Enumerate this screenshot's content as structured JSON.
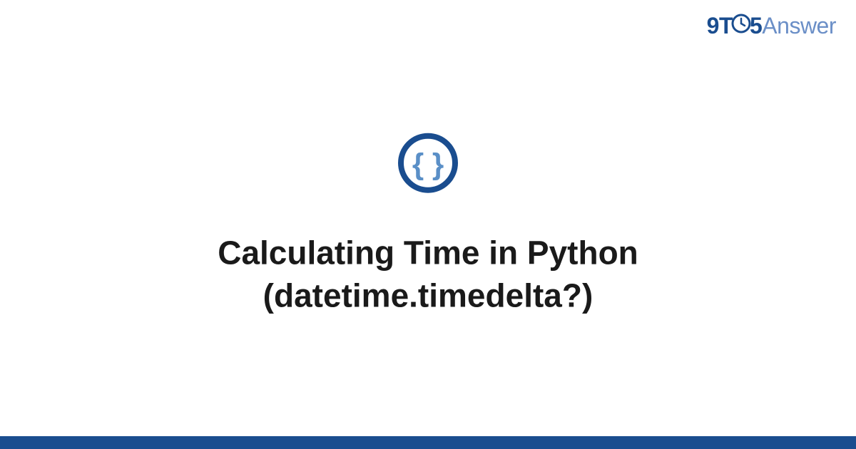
{
  "logo": {
    "part1": "9T",
    "part2": "5",
    "part3": "Answer"
  },
  "title": "Calculating Time in Python (datetime.timedelta?)",
  "colors": {
    "brand_dark": "#1a4d8f",
    "brand_light": "#6b8fc7",
    "icon_inner": "#5a8fc7",
    "text": "#1a1a1a"
  }
}
